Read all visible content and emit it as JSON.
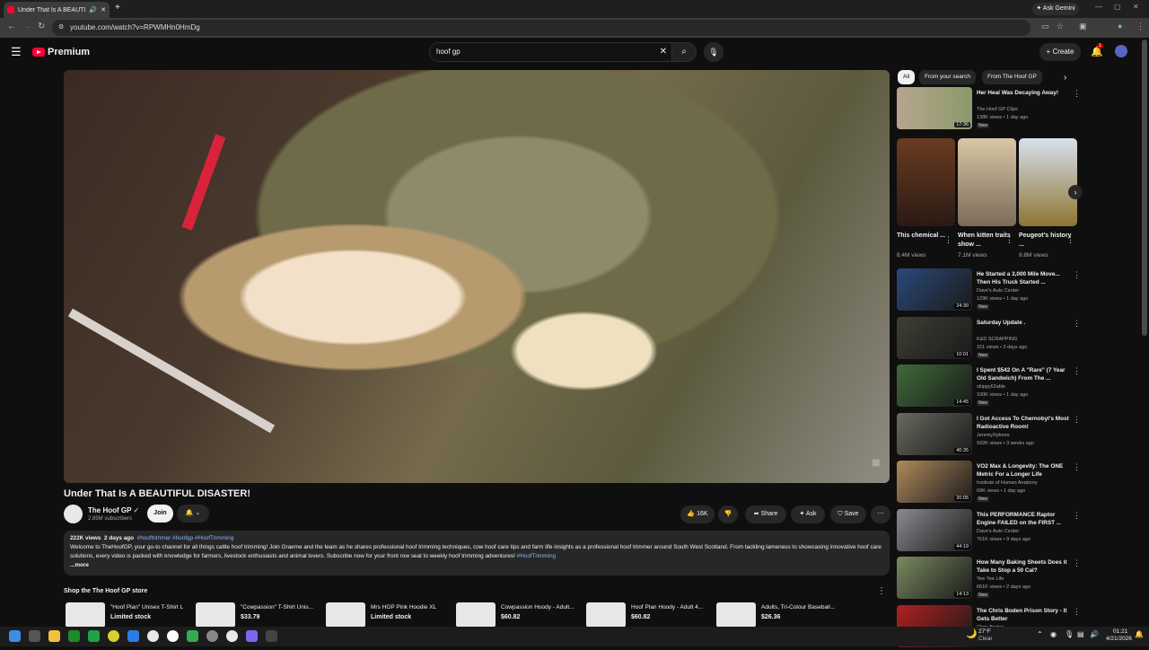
{
  "browser": {
    "tab_title": "Under That Is A BEAUTIFUL DISASTER!",
    "url": "youtube.com/watch?v=RPWMHn0HmDg",
    "ask_gemini": "Ask Gemini"
  },
  "header": {
    "logo_text": "Premium",
    "search_query": "hoof gp",
    "create_label": "Create",
    "notification_count": "1"
  },
  "video": {
    "title": "Under That Is A BEAUTIFUL DISASTER!",
    "channel": "The Hoof GP",
    "subscribers": "2.85M subscribers",
    "join_label": "Join",
    "likes": "16K",
    "share_label": "Share",
    "ask_label": "Ask",
    "save_label": "Save",
    "views": "222K views",
    "age": "2 days ago",
    "hashtags": "#hooftrimmer #hoofgp #HoofTrimming",
    "description": "Welcome to TheHoofGP, your go-to channel for all things cattle hoof trimming! Join Graeme and the team as he shares professional hoof trimming techniques, cow hoof care tips and farm life insights as a professional hoof trimmer around South West Scotland. From tackling lameness to showcasing innovative hoof care solutions, every video is packed with knowledge for farmers, livestock enthusiasts and animal lovers. Subscribe now for your front row seat to weekly hoof trimming adventures!",
    "desc_tag": "#HoofTrimming",
    "more_label": "...more"
  },
  "shop": {
    "heading": "Shop the The Hoof GP store",
    "items": [
      {
        "name": "\"Hoof Plan\" Unisex T-Shirt L",
        "price": "Limited stock"
      },
      {
        "name": "\"Cowpassion\" T-Shirt Unis...",
        "price": "$33.79"
      },
      {
        "name": "Mrs HGP Pink Hoodie XL",
        "price": "Limited stock"
      },
      {
        "name": "Cowpassion Hoody - Adult...",
        "price": "$60.82"
      },
      {
        "name": "Hoof Plan Hoody - Adult 4...",
        "price": "$60.82"
      },
      {
        "name": "Adults, Tri-Colour Baseball...",
        "price": "$26.36"
      }
    ]
  },
  "sidebar": {
    "chips": [
      "All",
      "From your search",
      "From The Hoof GP"
    ],
    "top": {
      "title": "Her Heal Was Decaying Away!",
      "channel": "The Hoof GP Clips",
      "views": "138K views • 1 day ago",
      "badge": "New",
      "duration": "17:36"
    },
    "shorts": [
      {
        "title": "This chemical ...",
        "views": "8.4M views"
      },
      {
        "title": "When kitten traits show ...",
        "views": "7.1M views"
      },
      {
        "title": "Peugeot's history ...",
        "views": "9.8M views"
      }
    ],
    "videos": [
      {
        "title": "He Started a 3,000 Mile Move... Then His Truck Started ...",
        "channel": "Dave's Auto Center",
        "views": "129K views • 1 day ago",
        "badge": "New",
        "duration": "24:30"
      },
      {
        "title": "Saturday Update .",
        "channel": "K&D SCRAPPING",
        "views": "151 views • 2 days ago",
        "badge": "New",
        "duration": "10:01"
      },
      {
        "title": "I Spent $542 On A \"Rare\" (7 Year Old Sandwich) From The ...",
        "channel": "skippy62able",
        "views": "100K views • 1 day ago",
        "badge": "New",
        "duration": "14:45"
      },
      {
        "title": "I Got Access To Chernobyl's Most Radioactive Room!",
        "channel": "JeremyXplores",
        "views": "932K views • 3 weeks ago",
        "badge": "",
        "duration": "40:35"
      },
      {
        "title": "VO2 Max & Longevity: The ONE Metric For a Longer Life",
        "channel": "Institute of Human Anatomy",
        "views": "69K views • 1 day ago",
        "badge": "New",
        "duration": "20:05"
      },
      {
        "title": "This PERFORMANCE Raptor Engine FAILED on the FIRST ...",
        "channel": "Dave's Auto Center",
        "views": "761K views • 9 days ago",
        "badge": "",
        "duration": "44:19"
      },
      {
        "title": "How Many Baking Sheets Does it Take to Stop a 50 Cal?",
        "channel": "Yee Yee Life",
        "views": "661K views • 2 days ago",
        "badge": "New",
        "duration": "14:13"
      },
      {
        "title": "The Chris Boden Prison Story - It Gets Better",
        "channel": "Chris Boden",
        "views": "",
        "badge": "",
        "duration": ""
      }
    ]
  },
  "taskbar": {
    "weather_temp": "27°F",
    "weather_desc": "Clear",
    "time": "01:21",
    "date": "4/21/2026"
  }
}
